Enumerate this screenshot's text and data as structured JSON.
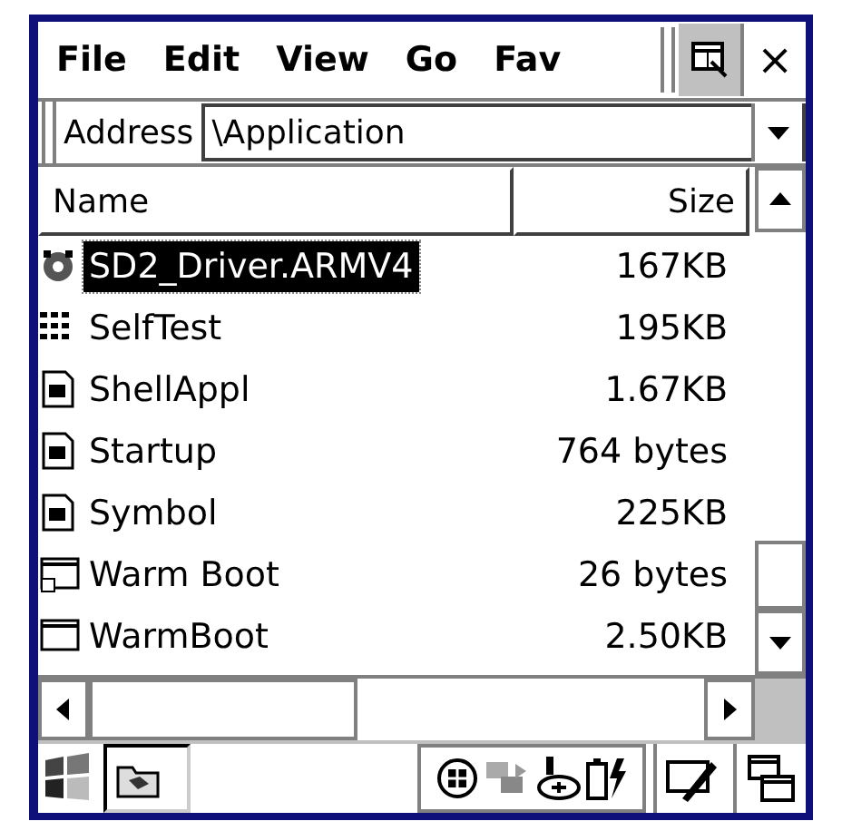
{
  "menu": [
    {
      "label": "File"
    },
    {
      "label": "Edit"
    },
    {
      "label": "View"
    },
    {
      "label": "Go"
    },
    {
      "label": "Fav"
    }
  ],
  "close_button": "×",
  "address": {
    "label": "Address",
    "value": "\\Application"
  },
  "columns": [
    "Name",
    "Size"
  ],
  "files": [
    {
      "name": "SD2_Driver.ARMV4",
      "size": "167KB",
      "kind": "driver",
      "selected": true
    },
    {
      "name": "SelfTest",
      "size": "195KB",
      "kind": "grid",
      "selected": false
    },
    {
      "name": "ShellAppl",
      "size": "1.67KB",
      "kind": "script",
      "selected": false
    },
    {
      "name": "Startup",
      "size": "764 bytes",
      "kind": "script",
      "selected": false
    },
    {
      "name": "Symbol",
      "size": "225KB",
      "kind": "script",
      "selected": false
    },
    {
      "name": "Warm Boot",
      "size": "26 bytes",
      "kind": "shortcut",
      "selected": false
    },
    {
      "name": "WarmBoot",
      "size": "2.50KB",
      "kind": "app",
      "selected": false
    }
  ]
}
